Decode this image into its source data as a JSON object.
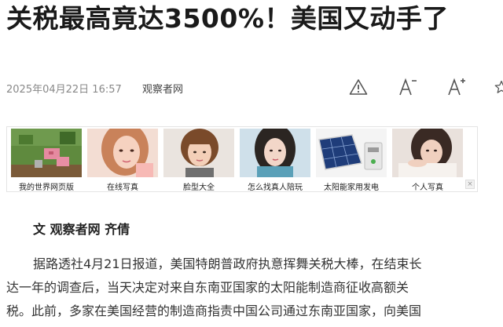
{
  "article": {
    "title": "关税最高竟达3500%！美国又动手了",
    "date": "2025年04月22日 16:57",
    "source": "观察者网",
    "byline": "文 观察者网 齐倩",
    "paragraph_lines": [
      "据路透社4月21日报道，美国特朗普政府执意挥舞关税大棒，在结束长",
      "达一年的调查后，当天决定对来自东南亚国家的太阳能制造商征收高额关",
      "税。此前，多家在美国经营的制造商指责中国公司通过东南亚国家，向美国"
    ]
  },
  "toolbar": {
    "report_icon": "warning-triangle-icon",
    "font_smaller_icon": "font-decrease-icon",
    "font_larger_icon": "font-increase-icon",
    "favorite_icon": "star-icon"
  },
  "ads": {
    "close_label": "×",
    "items": [
      {
        "label": "我的世界网页版",
        "icon": "minecraft-scene-thumbnail"
      },
      {
        "label": "在线写真",
        "icon": "portrait-photo-thumbnail"
      },
      {
        "label": "脸型大全",
        "icon": "face-shape-thumbnail"
      },
      {
        "label": "怎么找真人陪玩",
        "icon": "companion-photo-thumbnail"
      },
      {
        "label": "太阳能家用发电",
        "icon": "solar-panel-thumbnail"
      },
      {
        "label": "个人写真",
        "icon": "personal-portrait-thumbnail"
      }
    ]
  }
}
